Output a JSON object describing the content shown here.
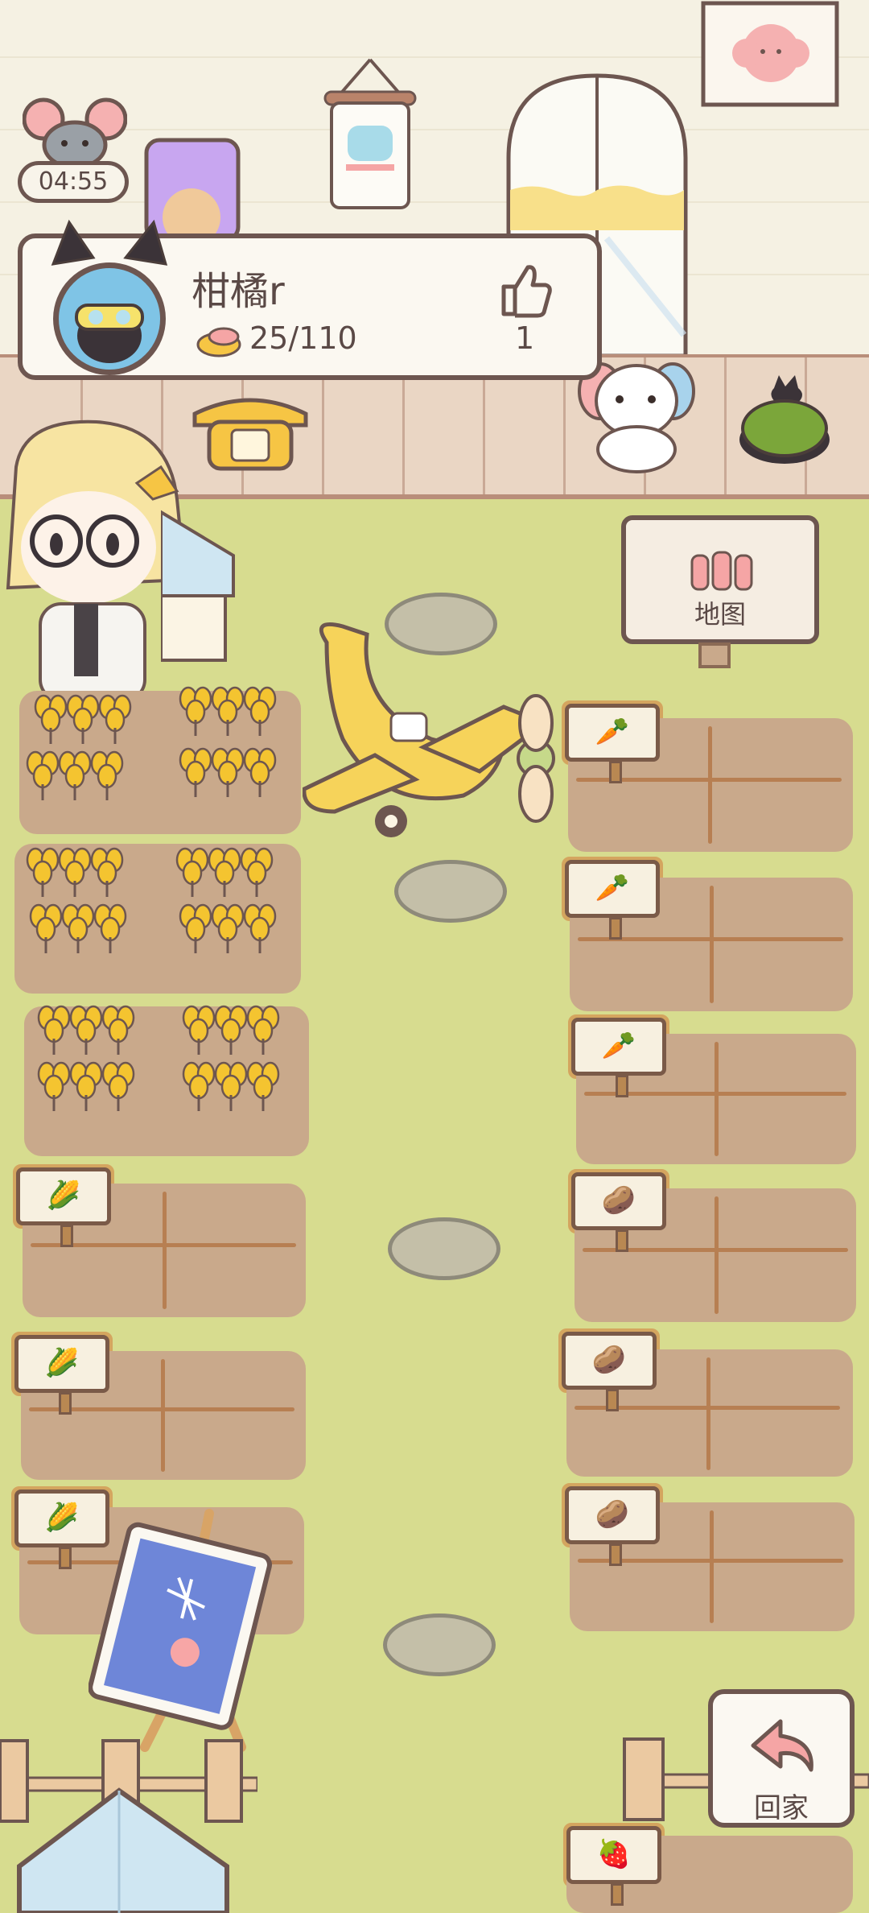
{
  "hud": {
    "timer": "04:55",
    "player_name": "柑橘r",
    "energy": "25/110",
    "likes": "1"
  },
  "buttons": {
    "map_label": "地图",
    "home_label": "回家"
  },
  "plots": {
    "left": [
      "wheat",
      "wheat",
      "wheat",
      "corn",
      "corn",
      "corn"
    ],
    "right": [
      "carrot",
      "carrot",
      "carrot",
      "potato",
      "potato",
      "potato",
      "strawberry"
    ]
  },
  "colors": {
    "grass": "#d7dc8f",
    "soil": "#c9a98b",
    "outline": "#6d5650",
    "wheat": "#f4c430",
    "card_bg": "#fbf8f1"
  }
}
